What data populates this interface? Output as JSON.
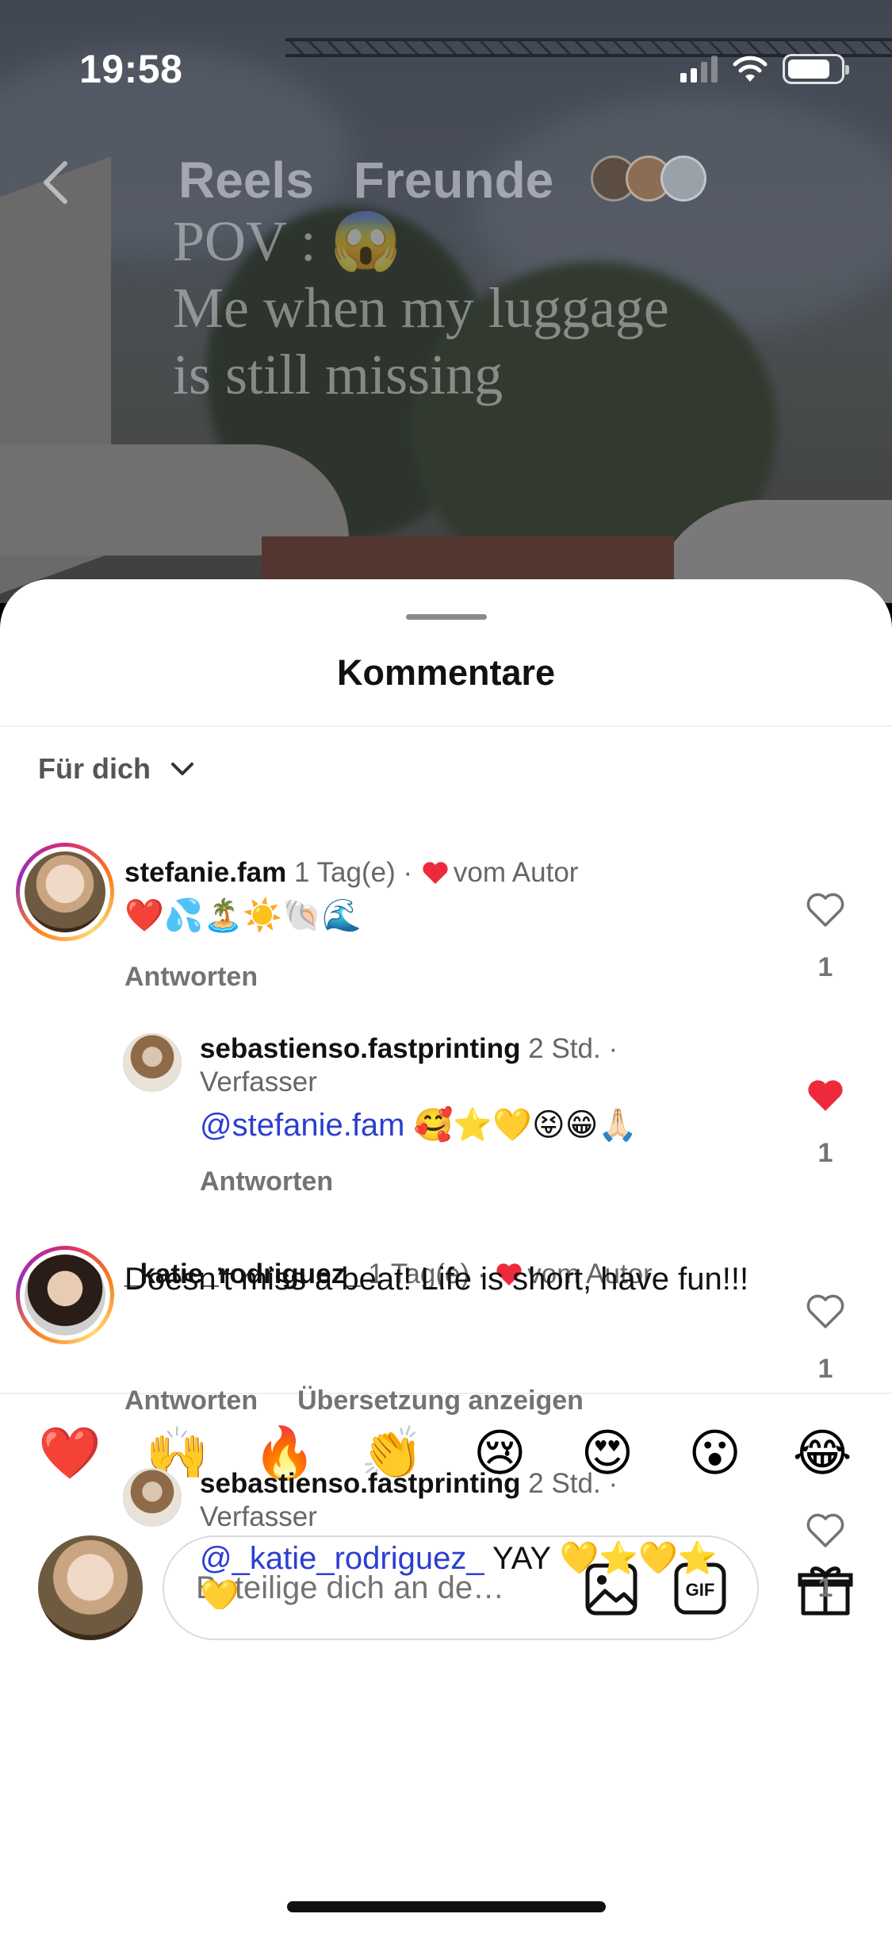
{
  "status_bar": {
    "time": "19:58"
  },
  "reel": {
    "tabs": [
      "Reels",
      "Freunde"
    ],
    "overlay_lines": [
      "POV : 😱",
      "Me when my luggage",
      "is still missing"
    ]
  },
  "sheet": {
    "title": "Kommentare",
    "filter_label": "Für dich"
  },
  "comments": [
    {
      "username": "stefanie.fam",
      "meta": "1 Tag(e) ·",
      "author_badge": "vom Autor",
      "text": "❤️💦🏝️☀️🐚🌊",
      "actions": [
        "Antworten"
      ],
      "likes": "1",
      "liked": false
    },
    {
      "username": "sebastienso.fastprinting",
      "meta": "2 Std. ·",
      "role": "Verfasser",
      "mention": "@stefanie.fam",
      "text": " 🥰⭐💛😝😁🙏🏻",
      "actions": [
        "Antworten"
      ],
      "likes": "1",
      "liked": true
    },
    {
      "username": "_katie_rodriguez_",
      "meta": "1 Tag(e) ·",
      "author_badge": "vom Autor",
      "text": "Doesn’t miss a beat! Life is short, have fun!!!",
      "actions": [
        "Antworten",
        "Übersetzung anzeigen"
      ],
      "likes": "1",
      "liked": false
    },
    {
      "username": "sebastienso.fastprinting",
      "meta": "2 Std. ·",
      "role": "Verfasser",
      "mention": "@_katie_rodriguez_",
      "text": " YAY 💛⭐💛⭐💛",
      "actions": [],
      "likes": "1",
      "liked": false
    }
  ],
  "reactions": [
    "❤️",
    "🙌",
    "🔥",
    "👏",
    "😢",
    "😍",
    "😮",
    "😂"
  ],
  "composer": {
    "placeholder": "Beteilige dich an de…",
    "gif_label": "GIF"
  },
  "colors": {
    "like_red": "#ed2a3c",
    "mention_blue": "#2b3fd0",
    "text_gray": "#737373"
  }
}
